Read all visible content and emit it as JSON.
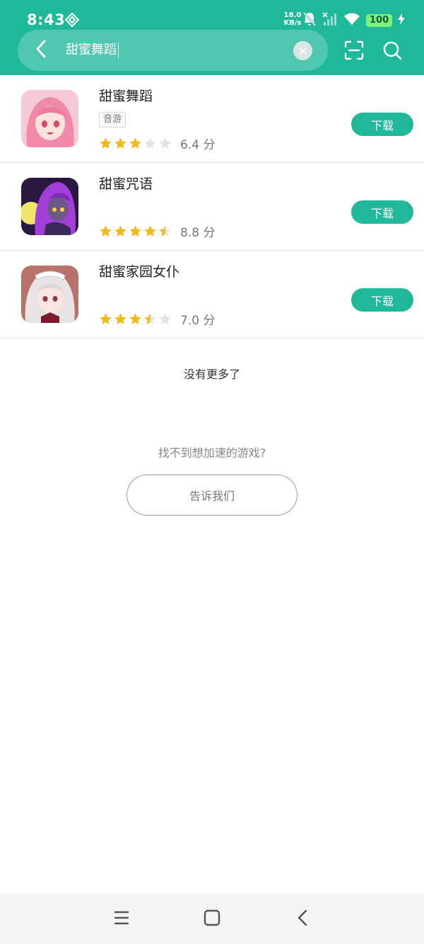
{
  "status_bar": {
    "time": "8:43",
    "net_speed_value": "18.0",
    "net_speed_unit": "KB/s",
    "battery": "100"
  },
  "search": {
    "query": "甜蜜舞蹈"
  },
  "games": [
    {
      "name": "甜蜜舞蹈",
      "tag": "音游",
      "rating": 3,
      "score": "6.4 分",
      "download_label": "下载"
    },
    {
      "name": "甜蜜咒语",
      "tag": "",
      "rating": 4.5,
      "score": "8.8 分",
      "download_label": "下载"
    },
    {
      "name": "甜蜜家园女仆",
      "tag": "",
      "rating": 3.5,
      "score": "7.0 分",
      "download_label": "下载"
    }
  ],
  "footer": {
    "no_more": "没有更多了",
    "hint": "找不到想加速的游戏?",
    "tell_us": "告诉我们"
  },
  "colors": {
    "accent": "#1fb99a",
    "star": "#f5b819",
    "star_empty": "#e3e3e3"
  },
  "icons": {
    "back": "chevron-left-icon",
    "clear": "close-icon",
    "scan": "scan-icon",
    "search": "search-icon",
    "nav_menu": "menu-icon",
    "nav_home": "home-square-icon",
    "nav_back": "back-triangle-icon"
  }
}
